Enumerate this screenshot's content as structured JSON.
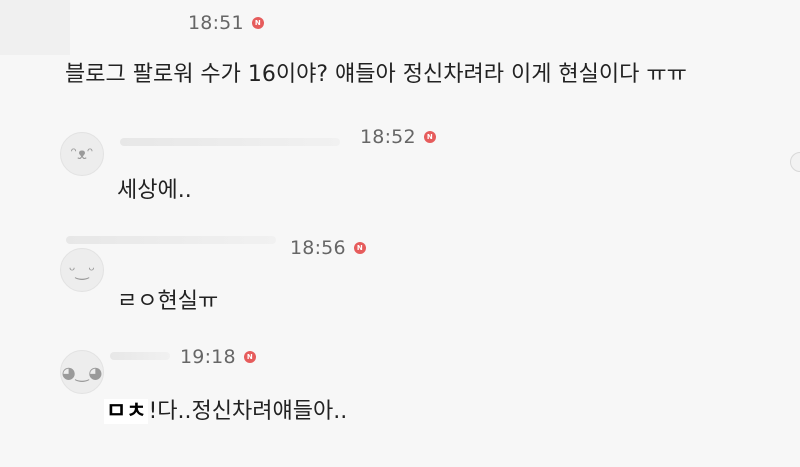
{
  "comments": [
    {
      "time": "18:51",
      "text": "블로그 팔로워 수가 16이야? 얘들아 정신차려라 이게 현실이다 ㅠㅠ"
    },
    {
      "time": "18:52",
      "text": "세상에.."
    },
    {
      "time": "18:56",
      "text": "ㄹㅇ현실ㅠ"
    },
    {
      "time": "19:18",
      "censor": "ㅁㅊ",
      "text": "!다..정신차려얘들아.."
    }
  ],
  "badge_label": "N",
  "colors": {
    "background": "#f7f7f7",
    "badge": "#e65c5c",
    "time": "#666666",
    "text": "#222222"
  }
}
